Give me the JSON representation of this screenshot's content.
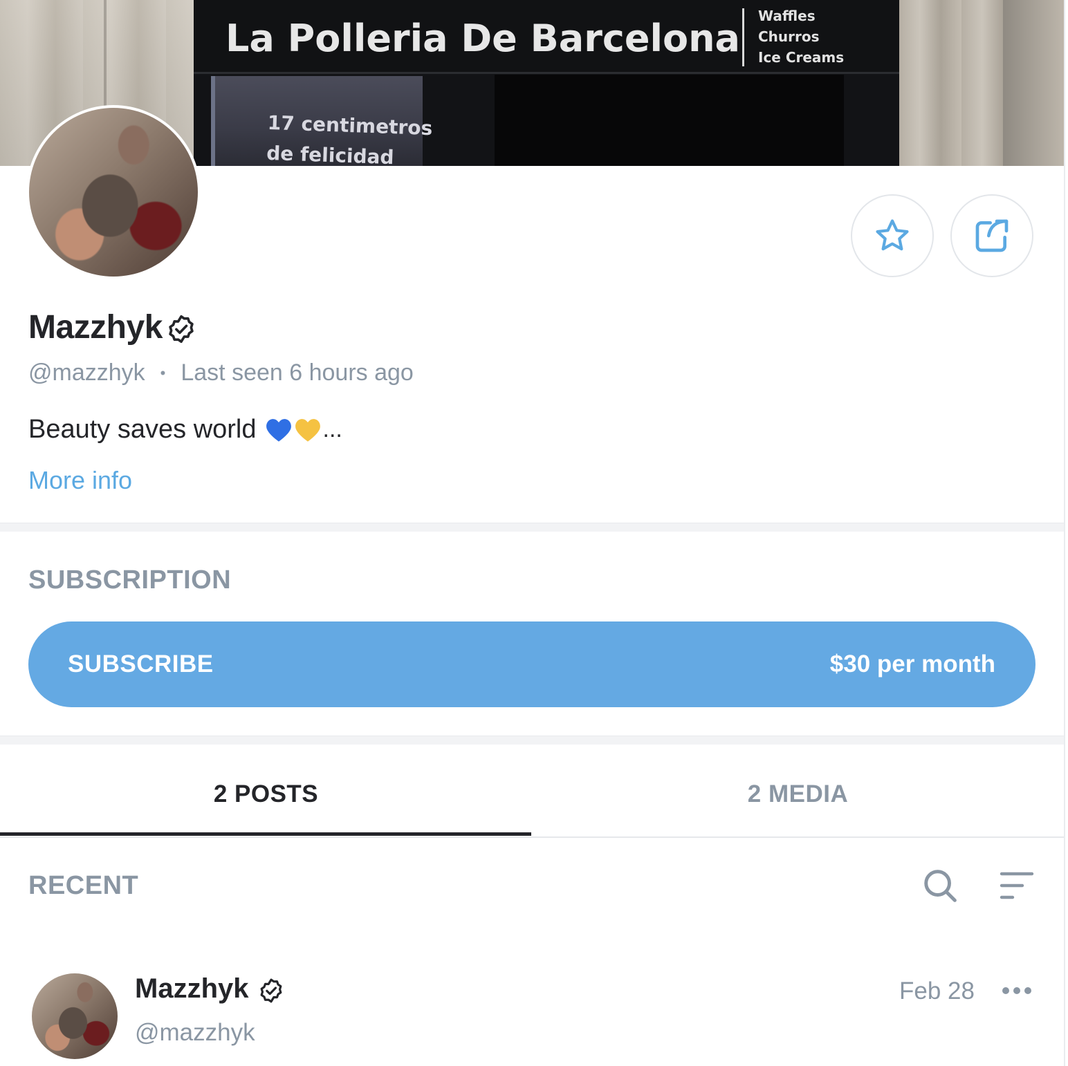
{
  "cover": {
    "sign_title": "La Polleria De Barcelona",
    "sign_side_lines": [
      "Waffles",
      "Churros",
      "Ice Creams"
    ],
    "window_lines": [
      "17 centimetros",
      "de felicidad"
    ]
  },
  "profile": {
    "name": "Mazzhyk",
    "handle": "@mazzhyk",
    "separator": "•",
    "last_seen": "Last seen 6 hours ago",
    "bio": "Beauty saves world",
    "bio_emoji": [
      "blue-heart",
      "yellow-heart"
    ],
    "bio_ellipsis": "...",
    "more_info": "More info"
  },
  "actions": {
    "favorite_icon": "star-icon",
    "share_icon": "share-icon"
  },
  "subscription": {
    "section_title": "SUBSCRIPTION",
    "button_label": "SUBSCRIBE",
    "price": "$30 per month"
  },
  "tabs": [
    {
      "label": "2 POSTS",
      "active": true
    },
    {
      "label": "2 MEDIA",
      "active": false
    }
  ],
  "recent": {
    "title": "RECENT",
    "search_icon": "search-icon",
    "sort_icon": "sort-icon"
  },
  "post": {
    "author": "Mazzhyk",
    "handle": "@mazzhyk",
    "date": "Feb 28",
    "more_icon": "more-icon"
  },
  "colors": {
    "accent": "#64a9e3",
    "link": "#5ba9e2",
    "muted": "#8a96a3",
    "text": "#242529"
  }
}
